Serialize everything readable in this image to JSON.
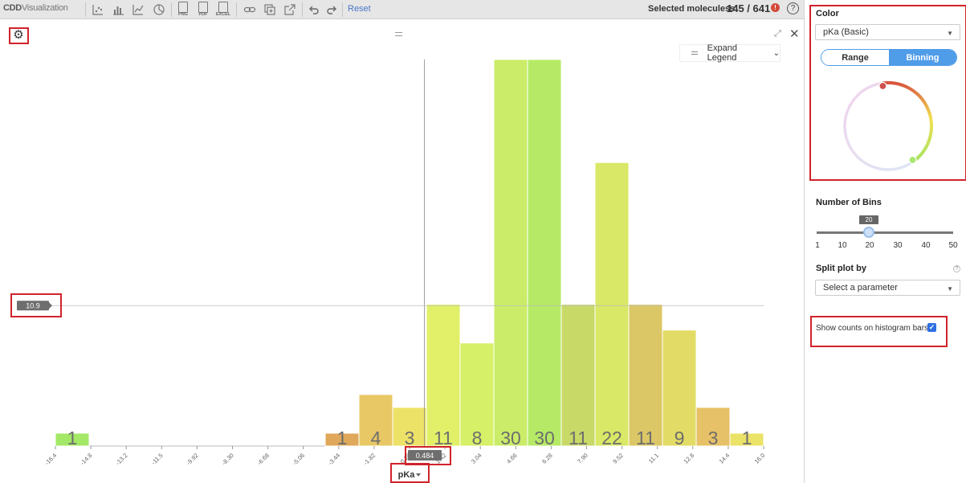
{
  "toolbar": {
    "logo_main": "CDD",
    "logo_sub": "Visualization",
    "file_exports": [
      {
        "label": "PNG",
        "icon": "png-export-icon"
      },
      {
        "label": "PDF",
        "icon": "pdf-export-icon"
      },
      {
        "label": "EXCEL",
        "icon": "excel-export-icon"
      }
    ],
    "reset_label": "Reset",
    "selected_label": "Selected moleculess",
    "selected_count": "145 / 641",
    "warning_glyph": "!",
    "help_glyph": "?"
  },
  "chart_panel": {
    "legend_button_label": "Expand Legend",
    "x_axis_dropdown_label": "pKa",
    "crosshair_x_value": "0.484",
    "crosshair_y_value": "10.9"
  },
  "chart_data": {
    "type": "bar",
    "x_tick_labels": [
      "-16.4",
      "-14.8",
      "-13.2",
      "-11.5",
      "-9.92",
      "-8.30",
      "-6.68",
      "-5.06",
      "-3.44",
      "-1.82",
      "-0.20",
      "1.42",
      "3.04",
      "4.66",
      "6.28",
      "7.90",
      "9.52",
      "11.1",
      "12.8",
      "14.4",
      "16.0"
    ],
    "bin_edges": [
      -16.4,
      -14.8,
      -13.2,
      -11.5,
      -9.92,
      -8.3,
      -6.68,
      -5.06,
      -3.44,
      -1.82,
      -0.2,
      1.42,
      3.04,
      4.66,
      6.28,
      7.9,
      9.52,
      11.1,
      12.8,
      14.4,
      16.0
    ],
    "counts": [
      1,
      0,
      0,
      0,
      0,
      0,
      0,
      0,
      1,
      4,
      3,
      11,
      8,
      30,
      30,
      11,
      22,
      11,
      9,
      3,
      1
    ],
    "colors": [
      "#a3e866",
      "",
      "",
      "",
      "",
      "",
      "",
      "",
      "#e0a85a",
      "#e8c865",
      "#ede268",
      "#e1f068",
      "#d6f068",
      "#cbec68",
      "#b6ea66",
      "#c9d968",
      "#d9e866",
      "#dcc766",
      "#e2dc66",
      "#e7c167",
      "#ebe268"
    ],
    "xlabel": "pKa",
    "show_counts": true,
    "crosshair": {
      "x": 0.484,
      "y": 10.9
    }
  },
  "panel": {
    "color_heading": "Color",
    "color_property": "pKa (Basic)",
    "toggle_range": "Range",
    "toggle_binning": "Binning",
    "bins_heading": "Number of Bins",
    "bins_value": "20",
    "bins_ticks": [
      "1",
      "10",
      "20",
      "30",
      "40",
      "50"
    ],
    "split_heading": "Split plot by",
    "split_help": "?",
    "split_placeholder": "Select a parameter",
    "show_counts_label": "Show counts on histogram bars",
    "show_counts_checked": "✓"
  }
}
